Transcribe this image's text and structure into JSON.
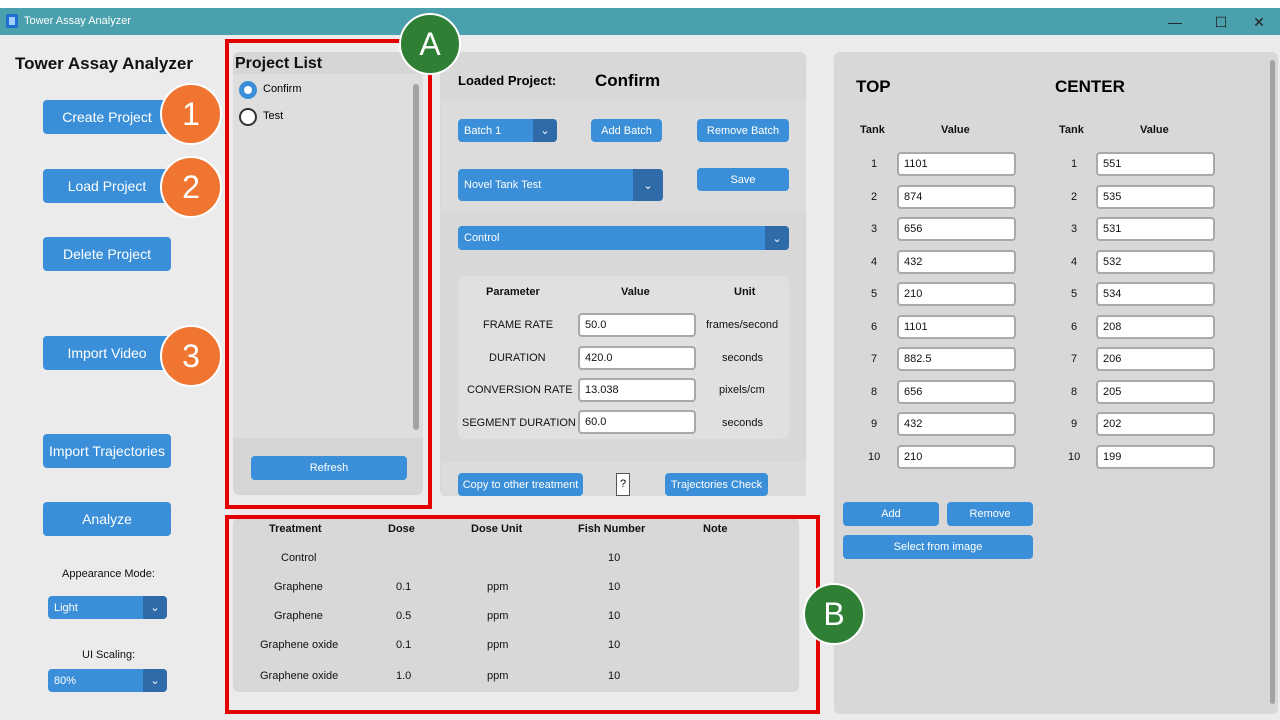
{
  "window": {
    "title": "Tower Assay Analyzer",
    "minimize": "—",
    "maximize": "☐",
    "close": "✕"
  },
  "sidebar": {
    "title": "Tower Assay Analyzer",
    "buttons": [
      "Create Project",
      "Load Project",
      "Delete Project",
      "Import Video",
      "Import Trajectories",
      "Analyze"
    ],
    "appearance_label": "Appearance Mode:",
    "appearance_value": "Light",
    "scaling_label": "UI Scaling:",
    "scaling_value": "80%"
  },
  "project_list": {
    "title": "Project List",
    "items": [
      {
        "label": "Confirm",
        "selected": true
      },
      {
        "label": "Test",
        "selected": false
      }
    ],
    "refresh": "Refresh"
  },
  "project": {
    "loaded_label": "Loaded Project:",
    "loaded_value": "Confirm",
    "batch_value": "Batch 1",
    "add_batch": "Add Batch",
    "remove_batch": "Remove Batch",
    "test_value": "Novel Tank Test",
    "save": "Save",
    "treatment_value": "Control",
    "params_headers": [
      "Parameter",
      "Value",
      "Unit"
    ],
    "params": [
      {
        "name": "FRAME RATE",
        "value": "50.0",
        "unit": "frames/second"
      },
      {
        "name": "DURATION",
        "value": "420.0",
        "unit": "seconds"
      },
      {
        "name": "CONVERSION RATE",
        "value": "13.038",
        "unit": "pixels/cm"
      },
      {
        "name": "SEGMENT DURATION",
        "value": "60.0",
        "unit": "seconds"
      }
    ],
    "copy": "Copy to other treatment",
    "help": "?",
    "traj_check": "Trajectories Check"
  },
  "treatments": {
    "headers": [
      "Treatment",
      "Dose",
      "Dose Unit",
      "Fish Number",
      "Note"
    ],
    "rows": [
      [
        "Control",
        "",
        "",
        "10",
        ""
      ],
      [
        "Graphene",
        "0.1",
        "ppm",
        "10",
        ""
      ],
      [
        "Graphene",
        "0.5",
        "ppm",
        "10",
        ""
      ],
      [
        "Graphene oxide",
        "0.1",
        "ppm",
        "10",
        ""
      ],
      [
        "Graphene oxide",
        "1.0",
        "ppm",
        "10",
        ""
      ]
    ]
  },
  "zones": {
    "top_title": "TOP",
    "center_title": "CENTER",
    "tank_header": "Tank",
    "value_header": "Value",
    "top_values": [
      "1101",
      "874",
      "656",
      "432",
      "210",
      "1101",
      "882.5",
      "656",
      "432",
      "210"
    ],
    "center_values": [
      "551",
      "535",
      "531",
      "532",
      "534",
      "208",
      "206",
      "205",
      "202",
      "199"
    ],
    "tanks": [
      "1",
      "2",
      "3",
      "4",
      "5",
      "6",
      "7",
      "8",
      "9",
      "10"
    ],
    "add": "Add",
    "remove": "Remove",
    "select_image": "Select from image"
  },
  "annotations": {
    "a": "A",
    "b": "B",
    "n1": "1",
    "n2": "2",
    "n3": "3"
  },
  "colors": {
    "accent": "#3a8fd8",
    "titlebar": "#4aa0ac",
    "highlight": "#e30000",
    "badge_orange": "#ef7531",
    "badge_green": "#2f7f34"
  }
}
